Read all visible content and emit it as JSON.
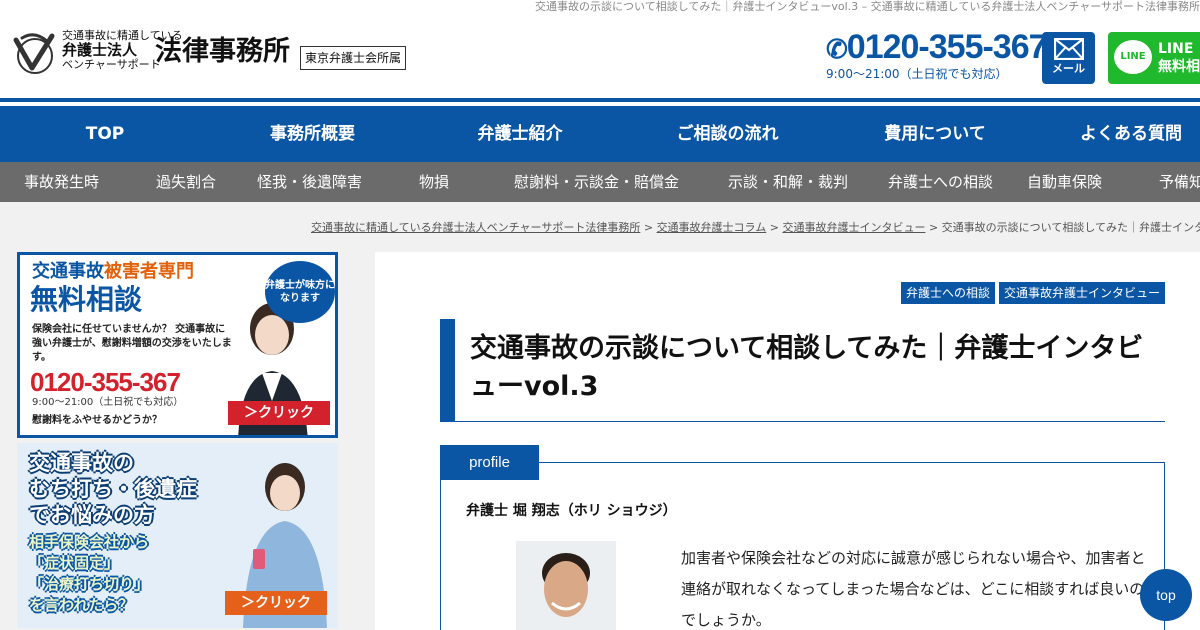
{
  "top_line": "交通事故の示談について相談してみた｜弁護士インタビューvol.3 – 交通事故に精通している弁護士法人ベンチャーサポート法律事務所",
  "header": {
    "logo_small": "交通事故に精通している",
    "logo_mid": "弁護士法人",
    "logo_bot": "ベンチャーサポート",
    "logo_big": "法律事務所",
    "logo_assoc": "東京弁護士会所属",
    "phone_number": "0120-355-367",
    "phone_hours": "9:00〜21:00（土日祝でも対応）",
    "mail_label": "メール",
    "line_icon": "LINE",
    "line_label_1": "LINE",
    "line_label_2": "無料相"
  },
  "global_nav": [
    "TOP",
    "事務所概要",
    "弁護士紹介",
    "ご相談の流れ",
    "費用について",
    "よくある質問"
  ],
  "sub_nav": [
    "事故発生時",
    "過失割合",
    "怪我・後遺障害",
    "物損",
    "慰謝料・示談金・賠償金",
    "示談・和解・裁判",
    "弁護士への相談",
    "自動車保険",
    "予備知"
  ],
  "breadcrumb": {
    "items": [
      "交通事故に精通している弁護士法人ベンチャーサポート法律事務所",
      "交通事故弁護士コラム",
      "交通事故弁護士インタビュー"
    ],
    "separator": ">",
    "current": "交通事故の示談について相談してみた｜弁護士インタビ"
  },
  "banner1": {
    "head_pre": "交通事故",
    "head_accent": "被害者専門",
    "head_big": "無料相談",
    "text": "保険会社に任せていませんか？ 交通事故に強い弁護士が、慰謝料増額の交渉をいたします。",
    "phone": "0120-355-367",
    "hours": "9:00〜21:00（土日祝でも対応）",
    "foot": "慰謝料をふやせるかどうか？",
    "bubble": "弁護士が味方になります",
    "click": "＞クリック"
  },
  "banner2": {
    "lines": [
      "交通事故の",
      "むち打ち・後遺症",
      "でお悩みの方"
    ],
    "subs": [
      "相手保険会社から",
      "「症状固定」",
      "「治療打ち切り」",
      "を言われたら？"
    ],
    "click": "＞クリック"
  },
  "article": {
    "tags": [
      "弁護士への相談",
      "交通事故弁護士インタビュー"
    ],
    "title": "交通事故の示談について相談してみた｜弁護士インタビューvol.3",
    "profile_tab": "profile",
    "lawyer_name": "弁護士 堀 翔志（ホリ ショウジ）",
    "profile_text": "加害者や保険会社などの対応に誠意が感じられない場合や、加害者と連絡が取れなくなってしまった場合などは、どこに相談すれば良いのでしょうか。"
  },
  "top_button": "top",
  "colors": {
    "brand_blue": "#0b56a4",
    "subnav_gray": "#6b6b6b",
    "line_green": "#20b82c",
    "accent_red": "#d3222b",
    "accent_orange": "#e5601b"
  }
}
